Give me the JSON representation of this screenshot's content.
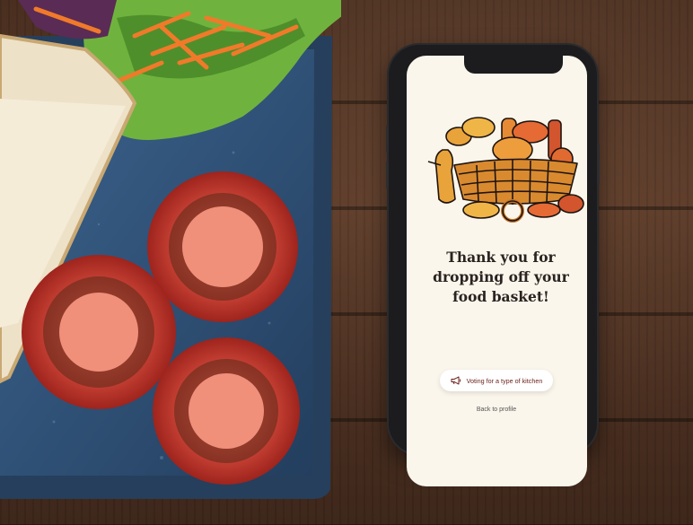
{
  "screen": {
    "message": "Thank you for dropping off your food basket!",
    "message_lines": [
      "Thank you for",
      "dropping off your",
      "food basket!"
    ],
    "vote_button_label": "Voting for a type of kitchen",
    "vote_icon": "megaphone-icon",
    "back_link_label": "Back to profile",
    "illustration": "bread-basket-illustration"
  },
  "colors": {
    "screen_bg": "#fbf6ec",
    "accent_text": "#6b1f1a",
    "heading_text": "#2a2320",
    "illustration_orange": "#e8a33a",
    "illustration_red": "#d2552d"
  }
}
